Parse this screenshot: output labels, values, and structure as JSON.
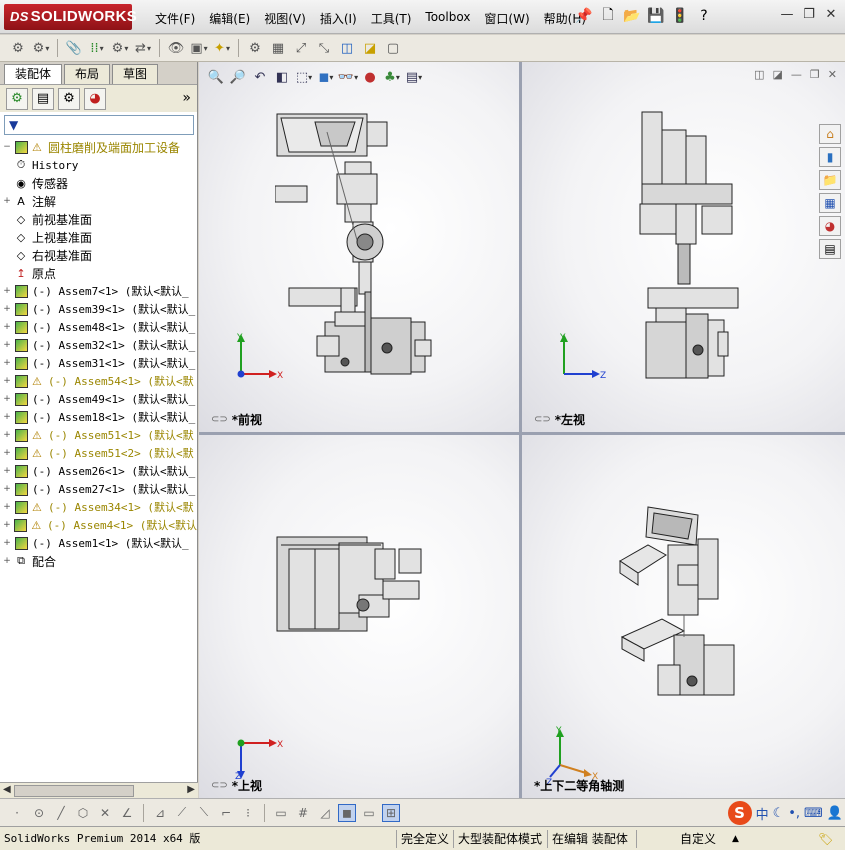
{
  "app": {
    "logo_prefix": "DS",
    "logo_text": "SOLIDWORKS"
  },
  "menu": [
    {
      "label": "文件(F)"
    },
    {
      "label": "编辑(E)"
    },
    {
      "label": "视图(V)"
    },
    {
      "label": "插入(I)"
    },
    {
      "label": "工具(T)"
    },
    {
      "label": "Toolbox"
    },
    {
      "label": "窗口(W)"
    },
    {
      "label": "帮助(H)"
    }
  ],
  "panel": {
    "tabs": [
      {
        "label": "装配体",
        "active": true
      },
      {
        "label": "布局",
        "active": false
      },
      {
        "label": "草图",
        "active": false
      }
    ],
    "more": "»",
    "filter": "▼"
  },
  "tree": {
    "root": "圆柱磨削及端面加工设备",
    "items": [
      {
        "label": "History",
        "icon": "history-icon",
        "cn": false
      },
      {
        "label": "传感器",
        "icon": "sensor-icon",
        "cn": true
      },
      {
        "label": "注解",
        "icon": "annotation-icon",
        "cn": true,
        "expand": "+"
      },
      {
        "label": "前视基准面",
        "icon": "plane-icon",
        "cn": true
      },
      {
        "label": "上视基准面",
        "icon": "plane-icon",
        "cn": true
      },
      {
        "label": "右视基准面",
        "icon": "plane-icon",
        "cn": true
      },
      {
        "label": "原点",
        "icon": "origin-icon",
        "cn": true
      }
    ],
    "components": [
      {
        "label": "(-) Assem7<1> (默认<默认_",
        "warn": false
      },
      {
        "label": "(-) Assem39<1> (默认<默认_",
        "warn": false
      },
      {
        "label": "(-) Assem48<1> (默认<默认_",
        "warn": false
      },
      {
        "label": "(-) Assem32<1> (默认<默认_",
        "warn": false
      },
      {
        "label": "(-) Assem31<1> (默认<默认_",
        "warn": false
      },
      {
        "label": "(-) Assem54<1> (默认<默",
        "warn": true
      },
      {
        "label": "(-) Assem49<1> (默认<默认_",
        "warn": false
      },
      {
        "label": "(-) Assem18<1> (默认<默认_",
        "warn": false
      },
      {
        "label": "(-) Assem51<1> (默认<默",
        "warn": true
      },
      {
        "label": "(-) Assem51<2> (默认<默",
        "warn": true
      },
      {
        "label": "(-) Assem26<1> (默认<默认_",
        "warn": false
      },
      {
        "label": "(-) Assem27<1> (默认<默认_",
        "warn": false
      },
      {
        "label": "(-) Assem34<1> (默认<默",
        "warn": true
      },
      {
        "label": "(-) Assem4<1> (默认<默认",
        "warn": true
      },
      {
        "label": "(-) Assem1<1> (默认<默认_",
        "warn": false
      }
    ],
    "mates": "配合"
  },
  "views": {
    "front": "*前视",
    "left": "*左视",
    "top": "*上视",
    "iso": "*上下二等角轴测"
  },
  "axes": {
    "x": "X",
    "y": "Y",
    "z": "Z"
  },
  "ime": {
    "logo": "S",
    "lang": "中"
  },
  "status": {
    "app": "SolidWorks Premium 2014 x64 版",
    "state": "完全定义",
    "mode": "大型装配体模式",
    "edit": "在编辑 装配体",
    "custom": "自定义",
    "caret": "▲"
  },
  "colors": {
    "brand_red": "#c8252c",
    "warning_text": "#9a8600",
    "axis_x": "#d02020",
    "axis_y": "#20a020",
    "axis_z": "#2040d0"
  }
}
